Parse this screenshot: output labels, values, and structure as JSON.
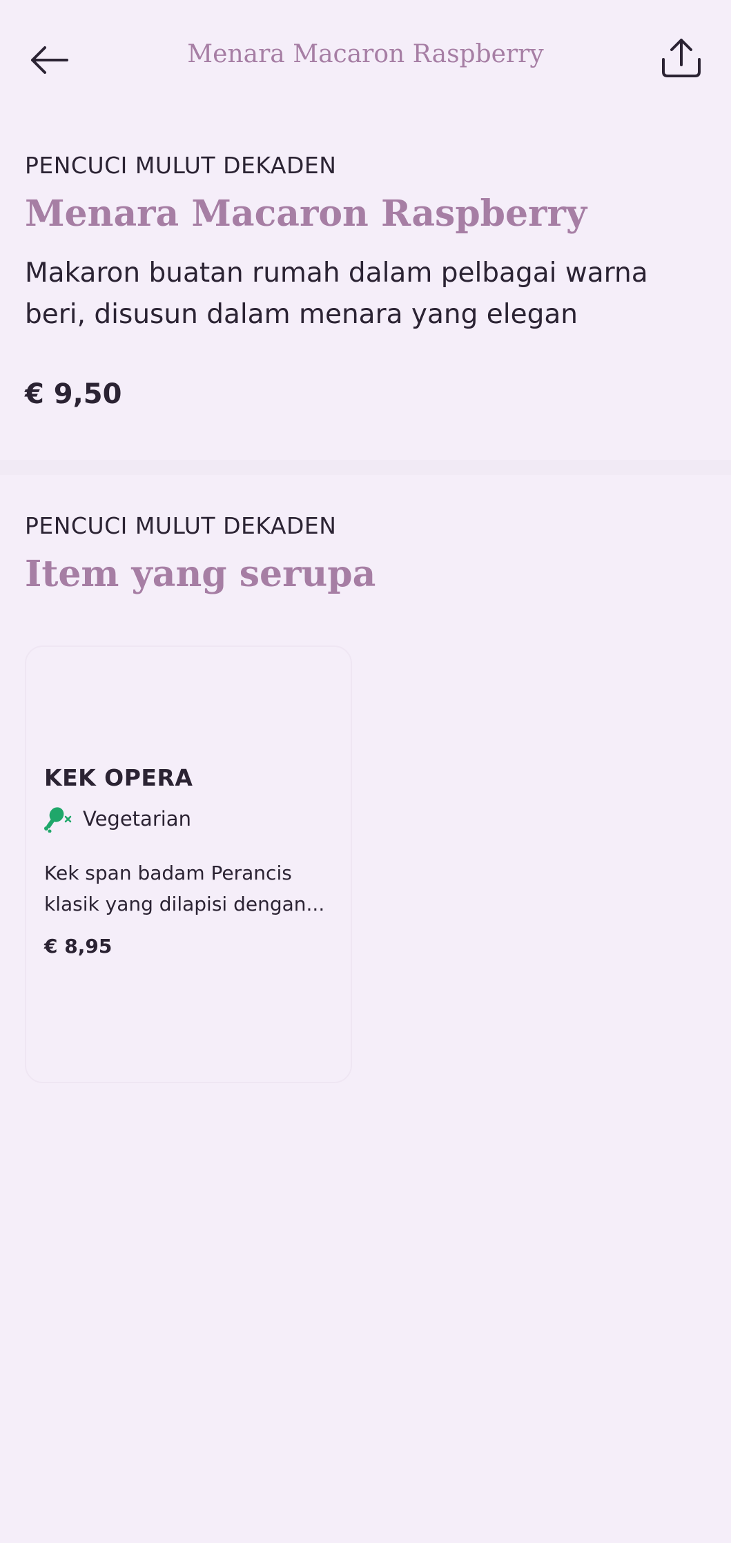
{
  "header": {
    "title": "Menara Macaron Raspberry",
    "back_icon": "arrow-left-icon",
    "share_icon": "share-icon"
  },
  "item": {
    "category": "PENCUCI MULUT DEKADEN",
    "name": "Menara Macaron Raspberry",
    "description": "Makaron buatan rumah dalam pelbagai warna beri, disusun dalam menara yang elegan",
    "price": "€ 9,50"
  },
  "similar": {
    "category": "PENCUCI MULUT DEKADEN",
    "heading": "Item yang serupa",
    "items": [
      {
        "name": "KEK OPERA",
        "diet_icon": "vegetarian-drumstick-icon",
        "diet_label": "Vegetarian",
        "description": "Kek span badam Perancis klasik yang dilapisi dengan...",
        "price": "€ 8,95"
      }
    ]
  },
  "colors": {
    "background": "#f5eef9",
    "accent": "#a67ea4",
    "text": "#2b2333",
    "vegetarian": "#1fa76a"
  }
}
